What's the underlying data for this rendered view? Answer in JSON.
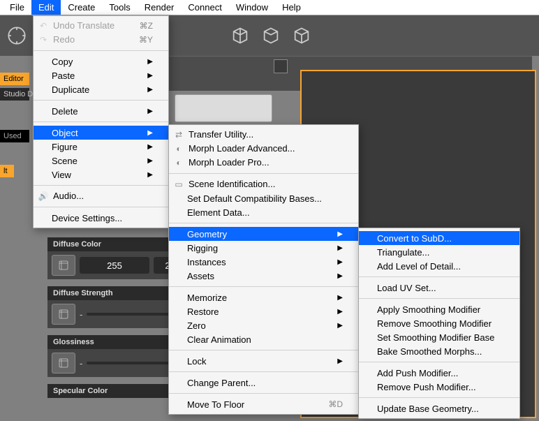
{
  "menubar": [
    "File",
    "Edit",
    "Create",
    "Tools",
    "Render",
    "Connect",
    "Window",
    "Help"
  ],
  "active_menu_index": 1,
  "edit_menu": {
    "undo": {
      "label": "Undo Translate",
      "shortcut": "⌘Z"
    },
    "redo": {
      "label": "Redo",
      "shortcut": "⌘Y"
    },
    "copy": "Copy",
    "paste": "Paste",
    "duplicate": "Duplicate",
    "delete": "Delete",
    "object": "Object",
    "figure": "Figure",
    "scene": "Scene",
    "view": "View",
    "audio": "Audio...",
    "device": "Device Settings..."
  },
  "object_menu": {
    "transfer": "Transfer Utility...",
    "mla": "Morph Loader Advanced...",
    "mlp": "Morph Loader Pro...",
    "sceneid": "Scene Identification...",
    "setdef": "Set Default Compatibility Bases...",
    "elem": "Element Data...",
    "geometry": "Geometry",
    "rigging": "Rigging",
    "instances": "Instances",
    "assets": "Assets",
    "memorize": "Memorize",
    "restore": "Restore",
    "zero": "Zero",
    "clearanim": "Clear Animation",
    "lock": "Lock",
    "changeparent": "Change Parent...",
    "movefloor": {
      "label": "Move To Floor",
      "shortcut": "⌘D"
    }
  },
  "geometry_menu": {
    "convert": "Convert to SubD...",
    "triangulate": "Triangulate...",
    "addlod": "Add Level of Detail...",
    "loaduv": "Load UV Set...",
    "applysm": "Apply Smoothing Modifier",
    "removesm": "Remove Smoothing Modifier",
    "setsm": "Set Smoothing Modifier Base",
    "bake": "Bake Smoothed Morphs...",
    "addpush": "Add Push Modifier...",
    "removepush": "Remove Push Modifier...",
    "updatebase": "Update Base Geometry..."
  },
  "left_tags": {
    "editor": "Editor",
    "studio": "Studio De",
    "used": "Used",
    "lt": "lt"
  },
  "props": {
    "diffuse_color": {
      "label": "Diffuse Color",
      "val1": "255",
      "val2": "2"
    },
    "diffuse_strength": {
      "label": "Diffuse Strength",
      "dash": "-"
    },
    "glossiness": {
      "label": "Glossiness",
      "dash": "-"
    },
    "specular_color": {
      "label": "Specular Color"
    }
  }
}
